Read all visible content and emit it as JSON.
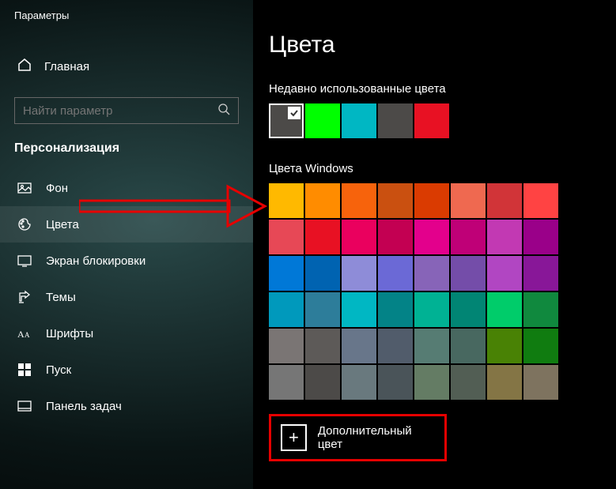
{
  "app_title": "Параметры",
  "home_label": "Главная",
  "search_placeholder": "Найти параметр",
  "section_title": "Персонализация",
  "nav": [
    {
      "id": "background",
      "label": "Фон"
    },
    {
      "id": "colors",
      "label": "Цвета"
    },
    {
      "id": "lockscreen",
      "label": "Экран блокировки"
    },
    {
      "id": "themes",
      "label": "Темы"
    },
    {
      "id": "fonts",
      "label": "Шрифты"
    },
    {
      "id": "start",
      "label": "Пуск"
    },
    {
      "id": "taskbar",
      "label": "Панель задач"
    }
  ],
  "active_nav": "colors",
  "page_title": "Цвета",
  "recent_title": "Недавно использованные цвета",
  "recent_colors": [
    {
      "hex": "#4c4a48",
      "selected": true
    },
    {
      "hex": "#00ff00"
    },
    {
      "hex": "#00b7c3"
    },
    {
      "hex": "#4c4a48"
    },
    {
      "hex": "#e81123"
    }
  ],
  "windows_colors_title": "Цвета Windows",
  "windows_colors": [
    "#ffb900",
    "#ff8c00",
    "#f7630c",
    "#ca5010",
    "#da3b01",
    "#ef6950",
    "#d13438",
    "#ff4343",
    "#e74856",
    "#e81123",
    "#ea005e",
    "#c30052",
    "#e3008c",
    "#bf0077",
    "#c239b3",
    "#9a0089",
    "#0078d7",
    "#0063b1",
    "#8e8cd8",
    "#6b69d6",
    "#8764b8",
    "#744da9",
    "#b146c2",
    "#881798",
    "#0099bc",
    "#2d7d9a",
    "#00b7c3",
    "#038387",
    "#00b294",
    "#018574",
    "#00cc6a",
    "#10893e",
    "#7a7574",
    "#5d5a58",
    "#68768a",
    "#515c6b",
    "#567c73",
    "#486860",
    "#498205",
    "#107c10",
    "#767676",
    "#4c4a48",
    "#69797e",
    "#4a5459",
    "#647c64",
    "#525e54",
    "#847545",
    "#7e735f"
  ],
  "custom_color_label": "Дополнительный цвет"
}
